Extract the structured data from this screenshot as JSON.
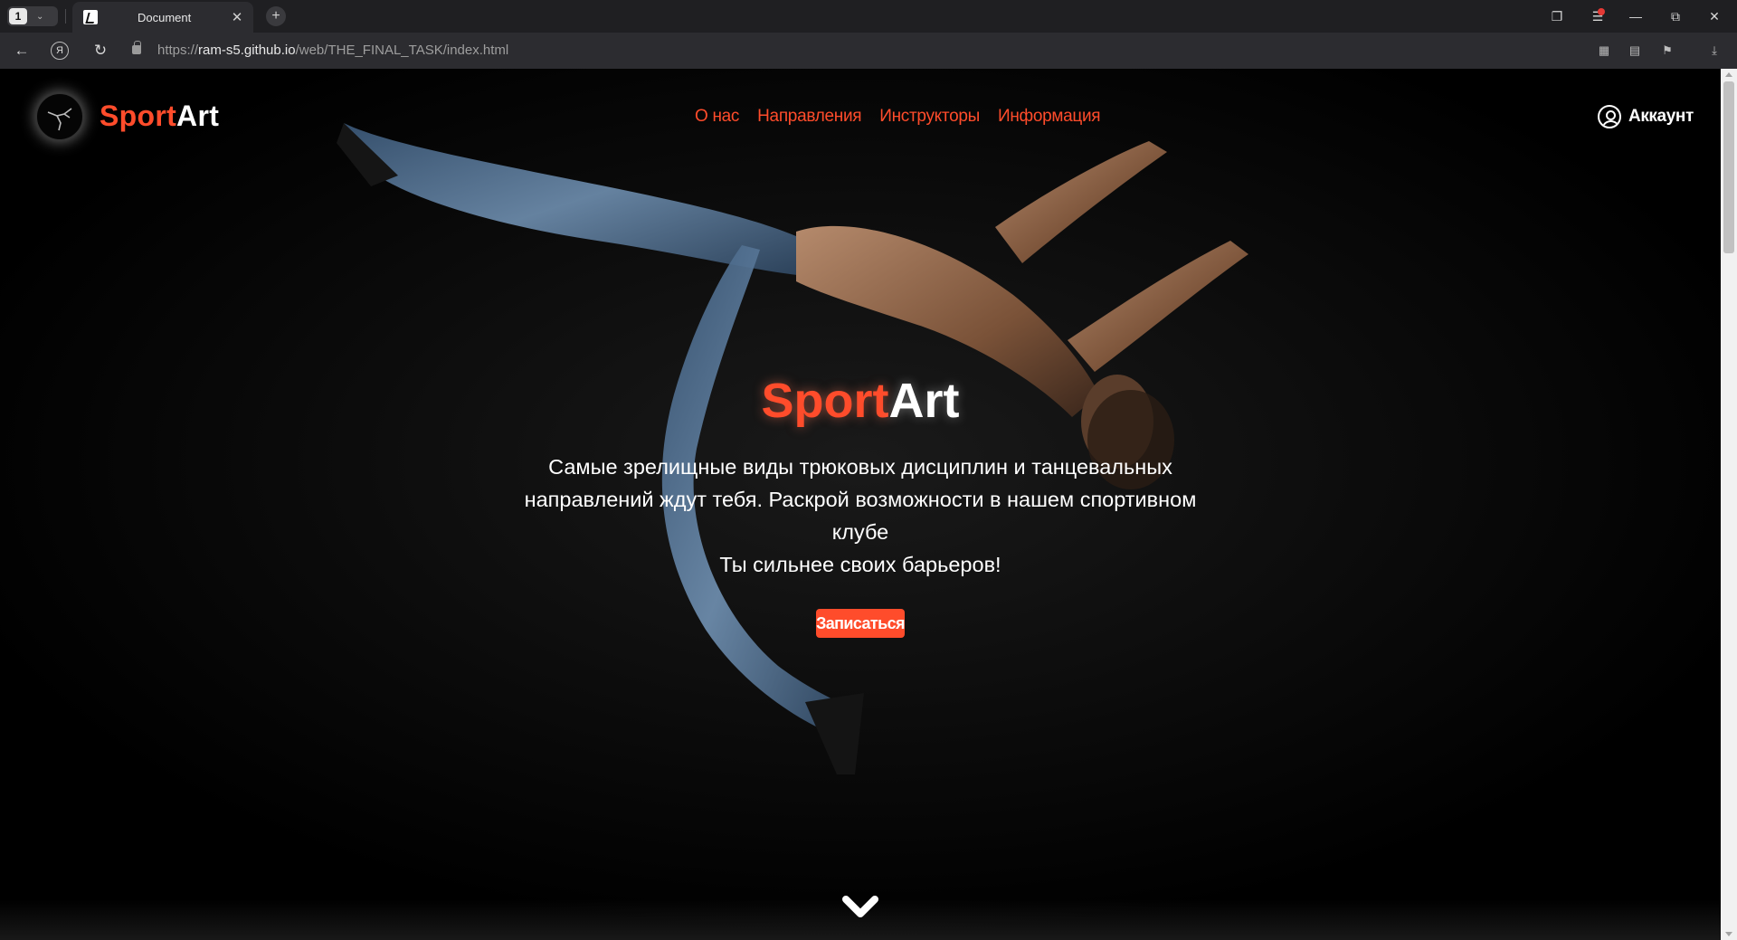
{
  "browser": {
    "tab_count": "1",
    "tab_title": "Document",
    "new_tab_symbol": "+",
    "url_prefix": "https://",
    "url_host": "ram-s5.github.io",
    "url_path": "/web/THE_FINAL_TASK/index.html"
  },
  "header": {
    "brand_part1": "Sport",
    "brand_part2": "Art",
    "nav": [
      "О нас",
      "Направления",
      "Инструкторы",
      "Информация"
    ],
    "account_label": "Аккаунт"
  },
  "hero": {
    "title_part1": "Sport",
    "title_part2": "Art",
    "text_line1": "Самые зрелищные виды трюковых дисциплин и танцевальных направлений ждут тебя. Раскрой возможности в нашем спортивном клубе",
    "text_line2": "Ты сильнее своих барьеров!",
    "cta_label": "Записаться"
  },
  "colors": {
    "accent": "#ff4c2b",
    "background": "#000000",
    "chrome": "#2c2c30"
  }
}
